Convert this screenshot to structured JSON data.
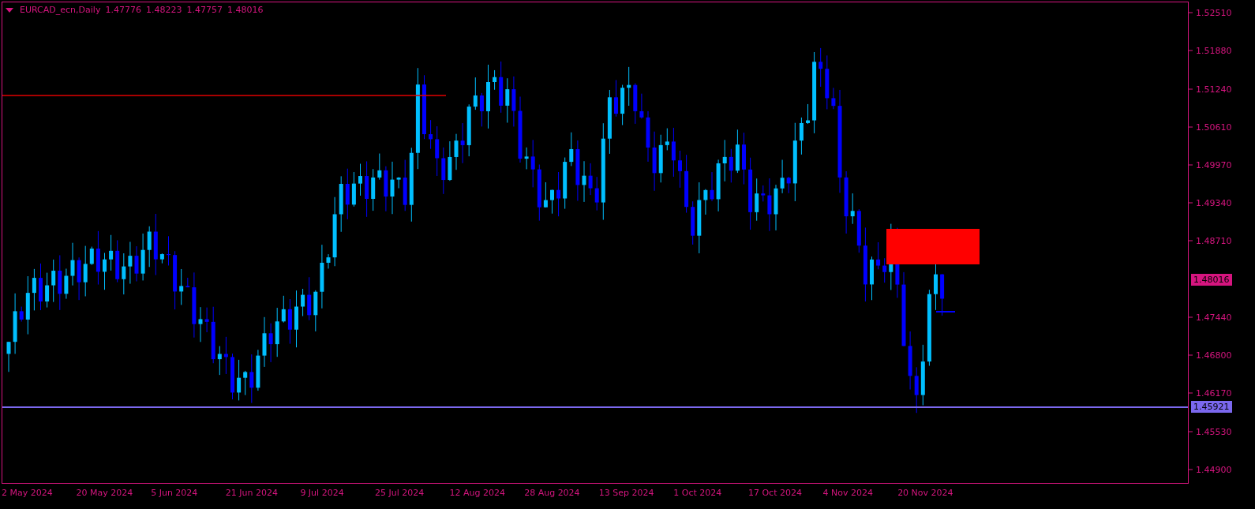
{
  "header": {
    "symbol": "EURCAD_ecn,Daily",
    "ohlc": [
      "1.47776",
      "1.48223",
      "1.47757",
      "1.48016"
    ]
  },
  "price_axis": [
    "1.52510",
    "1.51880",
    "1.51240",
    "1.50610",
    "1.49970",
    "1.49340",
    "1.48710",
    "1.47440",
    "1.46800",
    "1.46170",
    "1.45530",
    "1.44900"
  ],
  "current_price": "1.48016",
  "support_line": {
    "price": "1.45921"
  },
  "date_axis": [
    "2 May 2024",
    "20 May 2024",
    "5 Jun 2024",
    "21 Jun 2024",
    "9 Jul 2024",
    "25 Jul 2024",
    "12 Aug 2024",
    "28 Aug 2024",
    "13 Sep 2024",
    "1 Oct 2024",
    "17 Oct 2024",
    "4 Nov 2024",
    "20 Nov 2024"
  ]
}
